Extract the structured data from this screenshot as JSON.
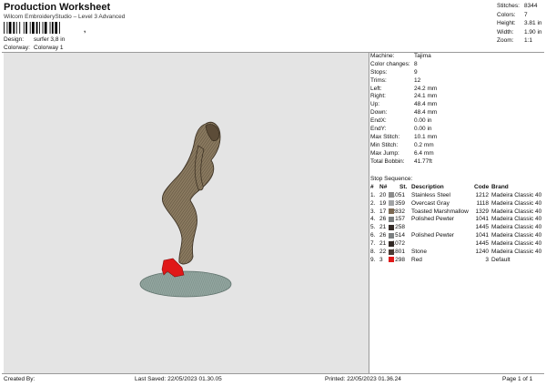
{
  "header": {
    "title": "Production Worksheet",
    "subtitle": "Wilcom EmbroideryStudio – Level 3 Advanced",
    "barcode_suffix": ","
  },
  "design_meta": [
    {
      "label": "Design:",
      "value": "surfer 3,8 in"
    },
    {
      "label": "Colorway:",
      "value": "Colorway 1"
    }
  ],
  "top_stats": [
    {
      "label": "Stitches:",
      "value": "8344"
    },
    {
      "label": "Colors:",
      "value": "7"
    },
    {
      "label": "Height:",
      "value": "3.81 in"
    },
    {
      "label": "Width:",
      "value": "1.90 in"
    },
    {
      "label": "Zoom:",
      "value": "1:1"
    }
  ],
  "machine_info": [
    {
      "label": "Machine:",
      "value": "Tajima"
    },
    {
      "label": "Color changes:",
      "value": "8"
    },
    {
      "label": "Stops:",
      "value": "9"
    },
    {
      "label": "Trims:",
      "value": "12"
    },
    {
      "label": "Left:",
      "value": "24.2 mm"
    },
    {
      "label": "Right:",
      "value": "24.1 mm"
    },
    {
      "label": "Up:",
      "value": "48.4 mm"
    },
    {
      "label": "Down:",
      "value": "48.4 mm"
    },
    {
      "label": "EndX:",
      "value": "0.00 in"
    },
    {
      "label": "EndY:",
      "value": "0.00 in"
    },
    {
      "label": "Max Stitch:",
      "value": "10.1 mm"
    },
    {
      "label": "Min Stitch:",
      "value": "0.2 mm"
    },
    {
      "label": "Max Jump:",
      "value": "6.4 mm"
    },
    {
      "label": "Total Bobbin:",
      "value": "41.77ft"
    }
  ],
  "stop_sequence": {
    "title": "Stop Sequence:",
    "headers": {
      "num": "#",
      "n": "N#",
      "st": "St.",
      "desc": "Description",
      "code": "Code",
      "brand": "Brand"
    },
    "rows": [
      {
        "num": "1.",
        "n": "20",
        "st": "1051",
        "color": "#8c8c8c",
        "desc": "Stainless Steel",
        "code": "1212",
        "brand": "Madeira Classic 40"
      },
      {
        "num": "2.",
        "n": "19",
        "st": "359",
        "color": "#a2a4a6",
        "desc": "Overcast Gray",
        "code": "1118",
        "brand": "Madeira Classic 40"
      },
      {
        "num": "3.",
        "n": "17",
        "st": "2832",
        "color": "#7c6a54",
        "desc": "Toasted Marshmallow",
        "code": "1329",
        "brand": "Madeira Classic 40"
      },
      {
        "num": "4.",
        "n": "26",
        "st": "157",
        "color": "#7b7f80",
        "desc": "Polished Pewter",
        "code": "1041",
        "brand": "Madeira Classic 40"
      },
      {
        "num": "5.",
        "n": "21",
        "st": "258",
        "color": "#332a26",
        "desc": "",
        "code": "1445",
        "brand": "Madeira Classic 40"
      },
      {
        "num": "6.",
        "n": "26",
        "st": "514",
        "color": "#7b7f80",
        "desc": "Polished Pewter",
        "code": "1041",
        "brand": "Madeira Classic 40"
      },
      {
        "num": "7.",
        "n": "21",
        "st": "1072",
        "color": "#332a26",
        "desc": "",
        "code": "1445",
        "brand": "Madeira Classic 40"
      },
      {
        "num": "8.",
        "n": "22",
        "st": "1801",
        "color": "#4a3b34",
        "desc": "Stone",
        "code": "1240",
        "brand": "Madeira Classic 40"
      },
      {
        "num": "9.",
        "n": "3",
        "st": "298",
        "color": "#e01818",
        "desc": "Red",
        "code": "3",
        "brand": "Default"
      }
    ]
  },
  "footer": {
    "created_by": "Created By:",
    "last_saved": "Last Saved: 22/05/2023 01.30.05",
    "printed": "Printed: 22/05/2023 01.36.24",
    "page": "Page 1 of 1"
  }
}
